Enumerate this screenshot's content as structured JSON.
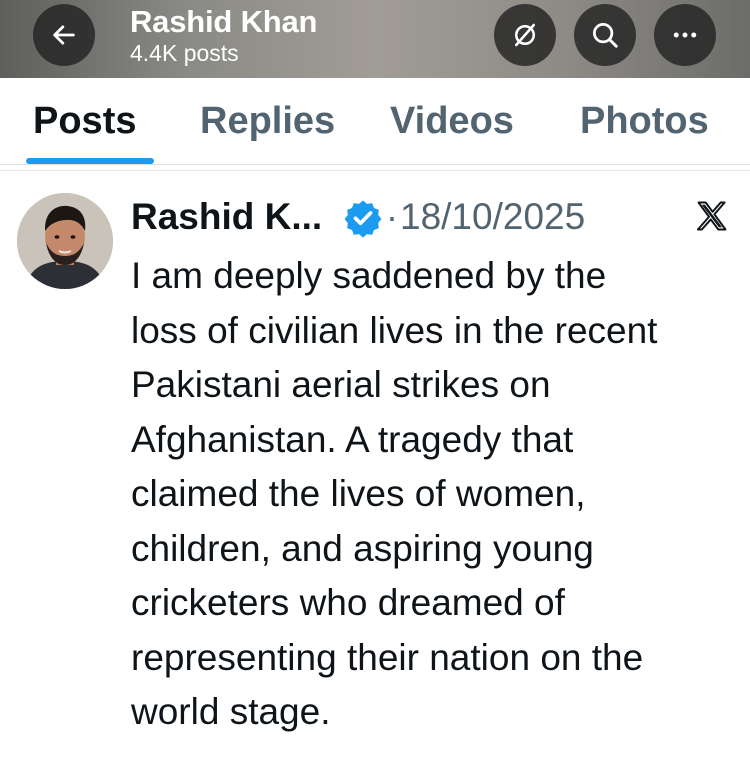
{
  "header": {
    "name": "Rashid Khan",
    "post_count": "4.4K posts"
  },
  "tabs": [
    {
      "label": "Posts",
      "active": true
    },
    {
      "label": "Replies",
      "active": false
    },
    {
      "label": "Videos",
      "active": false
    },
    {
      "label": "Photos",
      "active": false
    }
  ],
  "post": {
    "author_display": "Rashid K...",
    "verified": true,
    "separator": "·",
    "date": "18/10/2025",
    "source_icon": "x-logo-icon",
    "lines": [
      "I am deeply saddened by the",
      "loss of civilian lives in the recent",
      "Pakistani aerial strikes on",
      "Afghanistan. A tragedy that",
      "claimed the lives of women,",
      "children, and aspiring young",
      "cricketers who dreamed of",
      "representing their nation on the",
      "world stage."
    ]
  },
  "colors": {
    "accent": "#1d9bf0",
    "text_primary": "#0f1419",
    "text_secondary": "#536471",
    "header_button_bg": "#232323"
  },
  "icons": {
    "back": "arrow-left-icon",
    "mute": "notifications-off-icon",
    "search": "search-icon",
    "more": "more-horizontal-icon",
    "verified": "verified-badge-icon"
  }
}
